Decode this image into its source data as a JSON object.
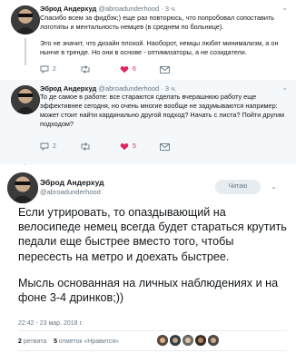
{
  "tweet1": {
    "name": "Эброд Андерхуд",
    "handle": "@abroadunderhood",
    "time": "3 ч.",
    "paragraphs": [
      "Спасибо всем за фидбэк;) еще раз повторюсь, что попробовал сопоставить логотипы и ментальность немцев (в среднем по больнице).",
      "Это не значит, что дизайн плохой. Наоборот, немцы любят минимализм, а он нынче в тренде. Но они в основе - оптимизаторы, а не созидатели."
    ],
    "replies": "2",
    "retweets": "",
    "likes": "6"
  },
  "tweet2": {
    "name": "Эброд Андерхуд",
    "handle": "@abroadunderhood",
    "time": "3 ч.",
    "text": "То де самое в работе: все стараются сделать вчерашнюю работу еще эффективнее сегодня, но очень многие вообще не задумываются например: может стоит найти кардинально другой подход? Начать с листа? Пойти другим подходом?",
    "replies": "2",
    "retweets": "",
    "likes": "5"
  },
  "main": {
    "name": "Эброд Андерхуд",
    "handle": "@abroadunderhood",
    "follow_label": "Читаю",
    "paragraphs": [
      "Если утрировать, то опаздывающий на велосипеде немец всегда будет стараться крутить педали еще быстрее вместо того, чтобы пересесть на метро и доехать быстрее.",
      "Мысль основанная на личных наблюдениях и на фоне 3-4 дринков;))"
    ],
    "timestamp": "22:42 - 23 мар. 2018 г.",
    "retweets_count": "2",
    "retweets_label": "ретвита",
    "likes_count": "5",
    "likes_label": "отметок «Нравится»"
  },
  "colors": {
    "accent": "#1da1f2",
    "like": "#e0245e",
    "muted": "#657786"
  }
}
